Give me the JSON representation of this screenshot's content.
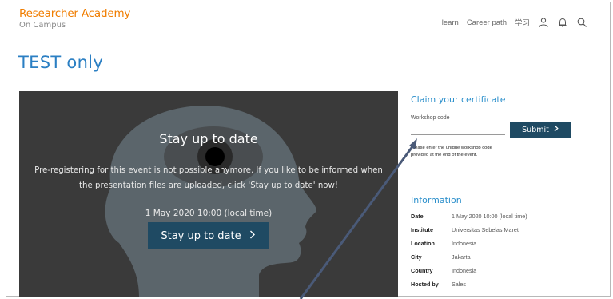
{
  "header": {
    "brand_name": "Researcher Academy",
    "brand_sub": "On Campus",
    "nav": {
      "learn": "learn",
      "career_path": "Career path",
      "lang": "学习"
    },
    "icons": [
      "user-icon",
      "bell-icon",
      "search-icon"
    ]
  },
  "page": {
    "title": "TEST only"
  },
  "hero": {
    "title": "Stay up to date",
    "message": "Pre-registering for this event is not possible anymore. If you like to be informed when the presentation files are uploaded, click 'Stay up to date' now!",
    "date": "1 May 2020 10:00 (local time)",
    "button_label": "Stay up to date",
    "button_icon": "chevron-right-icon",
    "colors": {
      "background": "#3b3b3b",
      "button": "#1f4a63"
    }
  },
  "certificate": {
    "title": "Claim your certificate",
    "code_label": "Workshop code",
    "code_value": "",
    "submit_label": "Submit",
    "help_text": "Please enter the unique workshop code provided at the end of the event."
  },
  "information": {
    "title": "Information",
    "rows": [
      {
        "key": "Date",
        "value": "1 May 2020 10:00 (local time)"
      },
      {
        "key": "Institute",
        "value": "Universitas Sebelas Maret"
      },
      {
        "key": "Location",
        "value": "Indonesia"
      },
      {
        "key": "City",
        "value": "Jakarta"
      },
      {
        "key": "Country",
        "value": "Indonesia"
      },
      {
        "key": "Hosted by",
        "value": "Sales"
      }
    ]
  },
  "colors": {
    "brand": "#f07d00",
    "accent": "#2b7fc3",
    "button": "#1f4a63"
  }
}
